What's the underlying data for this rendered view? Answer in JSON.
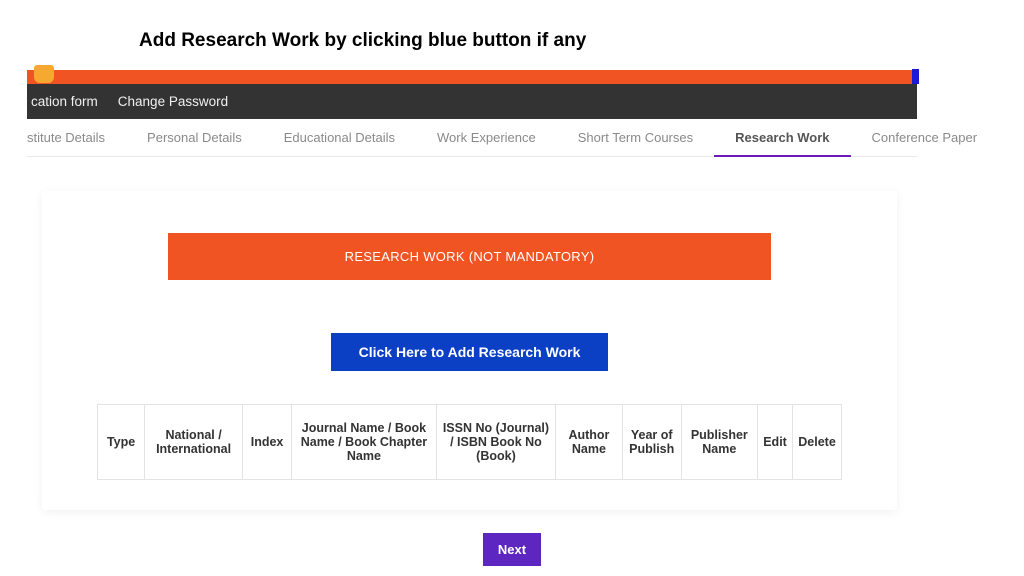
{
  "page_title": "Add Research Work by clicking blue button if any",
  "dark_nav": {
    "items": [
      "cation form",
      "Change Password"
    ]
  },
  "tabs": {
    "items": [
      {
        "label": "stitute Details"
      },
      {
        "label": "Personal Details"
      },
      {
        "label": "Educational Details"
      },
      {
        "label": "Work Experience"
      },
      {
        "label": "Short Term Courses"
      },
      {
        "label": "Research Work",
        "active": true
      },
      {
        "label": "Conference Paper"
      }
    ]
  },
  "panel": {
    "banner": "RESEARCH WORK (NOT MANDATORY)",
    "add_button": "Click Here to Add Research Work",
    "headers": [
      "Type",
      "National / International",
      "Index",
      "Journal Name / Book Name / Book Chapter Name",
      "ISSN No (Journal) / ISBN Book No (Book)",
      "Author Name",
      "Year of Publish",
      "Publisher Name",
      "Edit",
      "Delete"
    ]
  },
  "footer": {
    "next": "Next"
  }
}
